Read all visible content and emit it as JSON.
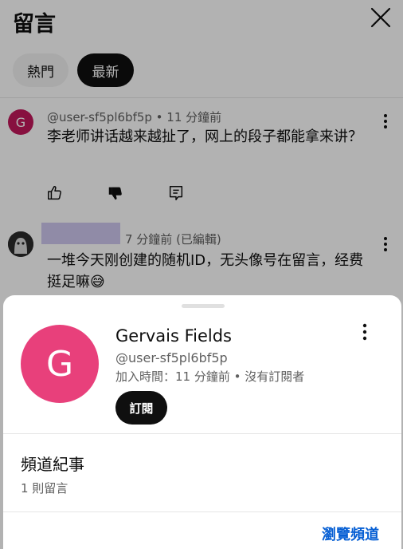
{
  "header": {
    "title": "留言"
  },
  "tabs": [
    {
      "label": "熱門",
      "active": false
    },
    {
      "label": "最新",
      "active": true
    }
  ],
  "comments": [
    {
      "avatar_letter": "G",
      "meta": "@user-sf5pl6bf5p • 11 分鐘前",
      "text": "李老师讲话越来越扯了，网上的段子都能拿来讲？"
    },
    {
      "meta": "7 分鐘前 (已編輯)",
      "text": "一堆今天刚创建的随机ID，无头像号在留言，经费挺足嘛😅"
    }
  ],
  "sheet": {
    "avatar_letter": "G",
    "avatar_color": "#e8407b",
    "name": "Gervais Fields",
    "handle": "@user-sf5pl6bf5p",
    "joined": "加入時間：11 分鐘前 • 沒有訂閱者",
    "subscribe_label": "訂閱",
    "section_title": "頻道紀事",
    "section_sub": "1 則留言",
    "browse_label": "瀏覽頻道"
  },
  "colors": {
    "accent_link": "#065fd4",
    "avatar_pink": "#e8407b",
    "avatar_small": "#c2185b"
  }
}
